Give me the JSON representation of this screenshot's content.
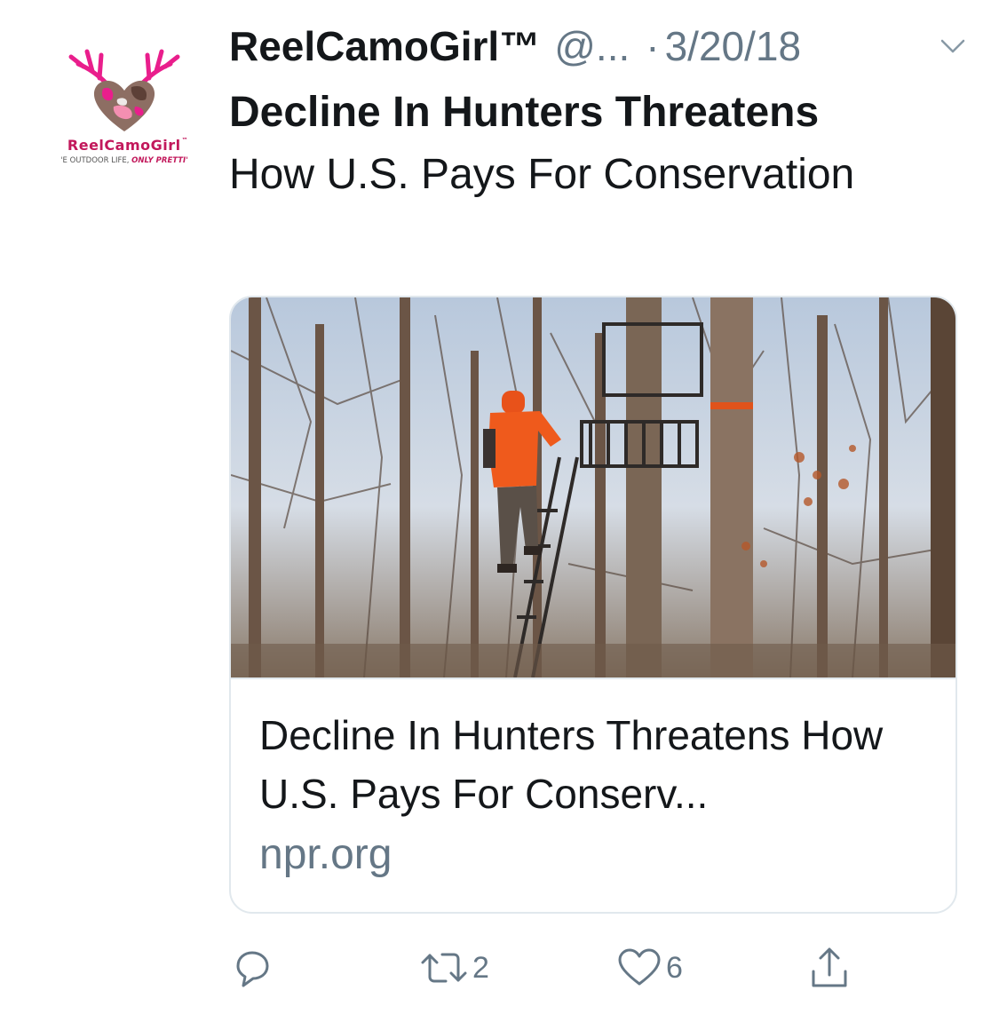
{
  "avatar": {
    "icon": "deer-antler-heart-logo",
    "logo_text": "ReelCamoGirl",
    "tagline_part1": "'E OUTDOOR LIFE, ",
    "tagline_part2": "ONLY PRETTI'",
    "brand_color": "#c2185b"
  },
  "tweet": {
    "display_name": "ReelCamoGirl™",
    "handle": "@...",
    "separator": "·",
    "date": "3/20/18",
    "text_bold": "Decline In Hunters Threatens",
    "text_rest": "How U.S. Pays For Conservation"
  },
  "card": {
    "image_alt": "hunter in orange climbing a tree stand in a bare forest",
    "title": "Decline In Hunters Threatens How U.S. Pays For Conserv...",
    "domain": "npr.org"
  },
  "actions": {
    "reply_icon": "reply-icon",
    "retweet_icon": "retweet-icon",
    "retweet_count": "2",
    "like_icon": "heart-icon",
    "like_count": "6",
    "share_icon": "share-icon"
  },
  "colors": {
    "text": "#14171a",
    "secondary": "#657786",
    "border": "#e1e8ed"
  }
}
